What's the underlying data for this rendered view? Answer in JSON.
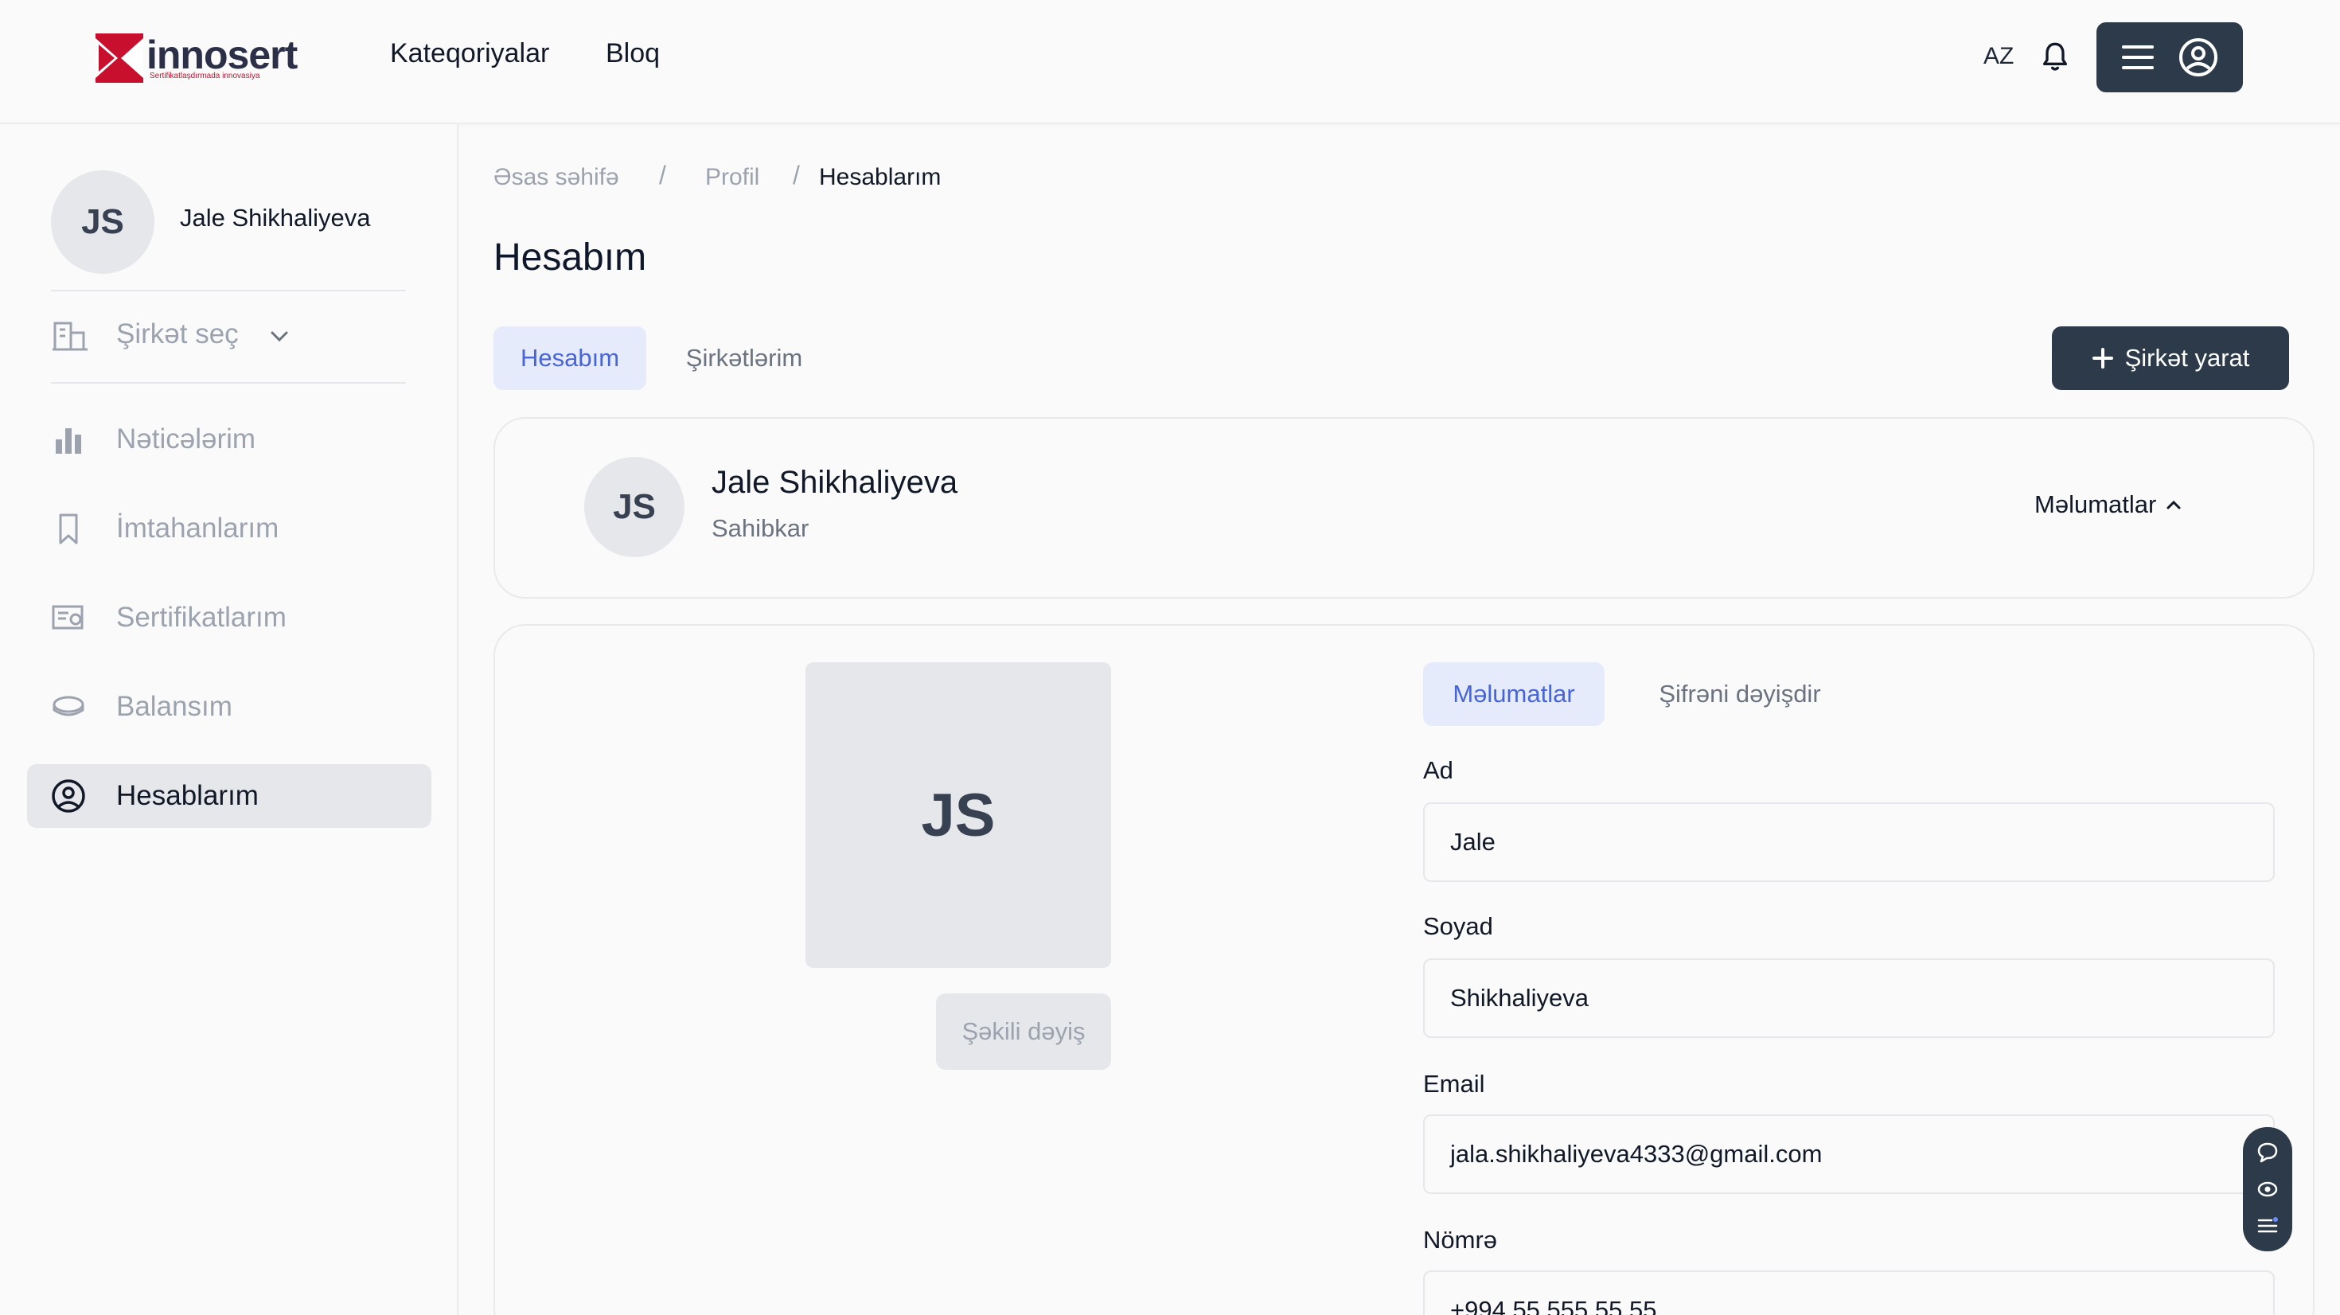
{
  "brand": {
    "name": "innosert",
    "tagline": "Sertifikatlaşdırmada innovasiya",
    "accent": "#c8102e",
    "dark": "#2d3a4a"
  },
  "nav": {
    "links": [
      "Kateqoriyalar",
      "Bloq"
    ],
    "language": "AZ"
  },
  "sidebar": {
    "initials": "JS",
    "user_name": "Jale Shikhaliyeva",
    "company_select": "Şirkət seç",
    "items": [
      {
        "label": "Nəticələrim",
        "icon": "bar-chart-icon"
      },
      {
        "label": "İmtahanlarım",
        "icon": "bookmark-icon"
      },
      {
        "label": "Sertifikatlarım",
        "icon": "certificate-icon"
      },
      {
        "label": "Balansım",
        "icon": "coin-icon"
      },
      {
        "label": "Hesablarım",
        "icon": "user-circle-icon",
        "active": true
      }
    ]
  },
  "breadcrumb": [
    "Əsas səhifə",
    "Profil",
    "Hesablarım"
  ],
  "page_title": "Hesabım",
  "tabs": [
    "Hesabım",
    "Şirkətlərim"
  ],
  "create_button": "Şirkət yarat",
  "profile_card": {
    "initials": "JS",
    "name": "Jale Shikhaliyeva",
    "role": "Sahibkar",
    "toggle": "Məlumatlar"
  },
  "photo": {
    "initials": "JS",
    "change_label": "Şəkili dəyiş"
  },
  "form_tabs": [
    "Məlumatlar",
    "Şifrəni dəyişdir"
  ],
  "form": {
    "first_name_label": "Ad",
    "first_name": "Jale",
    "last_name_label": "Soyad",
    "last_name": "Shikhaliyeva",
    "email_label": "Email",
    "email": "jala.shikhaliyeva4333@gmail.com",
    "phone_label": "Nömrə",
    "phone": "+994 55 555 55 55"
  }
}
